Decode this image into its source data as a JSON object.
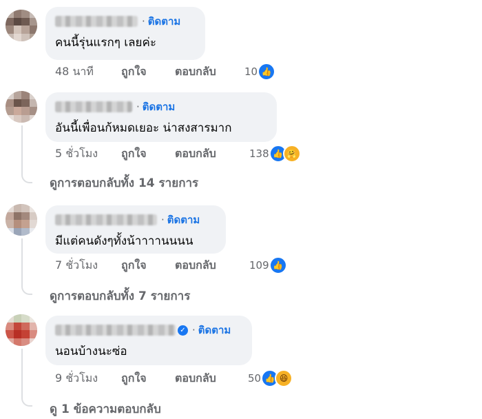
{
  "follow_label": "ติดตาม",
  "dot": "·",
  "comments": [
    {
      "text": "คนนี้รุ่นแรกๆ เลยค่ะ",
      "time": "48 นาที",
      "like_label": "ถูกใจ",
      "reply_label": "ตอบกลับ",
      "reaction_count": "10",
      "reactions": [
        "like-icon"
      ],
      "verified": false
    },
    {
      "text": "อันนี้เพื่อนก้หมดเยอะ น่าสงสารมาก",
      "time": "5 ชั่วโมง",
      "like_label": "ถูกใจ",
      "reply_label": "ตอบกลับ",
      "reaction_count": "138",
      "reactions": [
        "like-icon",
        "care-icon"
      ],
      "view_replies": "ดูการตอบกลับทั้ง 14 รายการ",
      "verified": false
    },
    {
      "text": "มีแต่คนดังๆทั้งน้าาาานนนน",
      "time": "7 ชั่วโมง",
      "like_label": "ถูกใจ",
      "reply_label": "ตอบกลับ",
      "reaction_count": "109",
      "reactions": [
        "like-icon"
      ],
      "view_replies": "ดูการตอบกลับทั้ง 7 รายการ",
      "verified": false
    },
    {
      "text": "นอนบ้างนะซ่อ",
      "time": "9 ชั่วโมง",
      "like_label": "ถูกใจ",
      "reply_label": "ตอบกลับ",
      "reaction_count": "50",
      "reactions": [
        "like-icon",
        "haha-icon"
      ],
      "view_replies": "ดู 1 ข้อความตอบกลับ",
      "verified": true
    }
  ],
  "colors": {
    "bubble": "#f0f2f5",
    "follow": "#1b74e4",
    "meta": "#65676b",
    "like_reaction": "#1877f2",
    "emoji_reaction": "#f7b125"
  }
}
